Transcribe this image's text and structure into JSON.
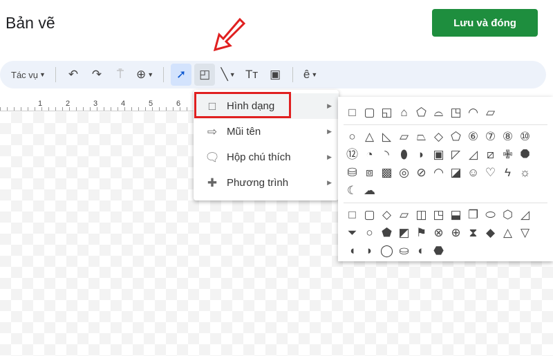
{
  "header": {
    "title": "Bản vẽ",
    "save_button": "Lưu và đóng"
  },
  "toolbar": {
    "actions": "Tác vụ",
    "undo": "↶",
    "redo": "↷",
    "paint": "⍑",
    "zoom": "⊕",
    "select": "➚",
    "shape": "◰",
    "line": "╲",
    "text": "Tт",
    "image": "▣",
    "font": "ê"
  },
  "ruler": [
    "1",
    "2",
    "3",
    "4",
    "5",
    "6"
  ],
  "menu": [
    {
      "label": "Hình dạng",
      "icon": "□",
      "icon_name": "square-icon"
    },
    {
      "label": "Mũi tên",
      "icon": "⇨",
      "icon_name": "arrow-icon"
    },
    {
      "label": "Hộp chú thích",
      "icon": "🗨",
      "icon_name": "callout-icon"
    },
    {
      "label": "Phương trình",
      "icon": "✚",
      "icon_name": "plus-icon"
    }
  ],
  "shapes": {
    "rectangles": [
      "□",
      "▢",
      "◱",
      "⌂",
      "⬠",
      "⌓",
      "◳",
      "◠",
      "▱"
    ],
    "basic": [
      "○",
      "△",
      "◺",
      "▱",
      "⏢",
      "◇",
      "⬠",
      "⑥",
      "⑦",
      "⑧",
      "⑩",
      "⑫",
      "◔",
      "◝",
      "⬮",
      "◗",
      "▣",
      "◸",
      "◿",
      "⧄",
      "✙",
      "⯃",
      "⛁",
      "⧈",
      "▩",
      "◎",
      "⊘",
      "◠",
      "◪",
      "☺",
      "♡",
      "ϟ",
      "☼",
      "☾",
      "☁"
    ],
    "flowchart": [
      "□",
      "▢",
      "◇",
      "▱",
      "◫",
      "◳",
      "⬓",
      "❐",
      "⬭",
      "⬡",
      "◿",
      "⏷",
      "○",
      "⬟",
      "◩",
      "⚑",
      "⊗",
      "⊕",
      "⧗",
      "◆",
      "△",
      "▽",
      "◖",
      "◗",
      "◯",
      "⛀",
      "◐",
      "⬣"
    ]
  }
}
